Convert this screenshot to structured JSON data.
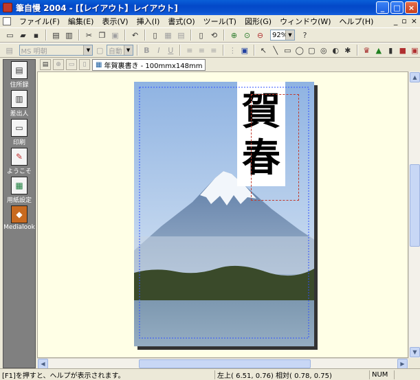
{
  "window": {
    "title": "筆自慢 2004 - [【レイアウト】レイアウト]",
    "minimize_label": "_",
    "maximize_label": "□",
    "close_label": "×"
  },
  "menu": {
    "items": [
      "ファイル(F)",
      "編集(E)",
      "表示(V)",
      "挿入(I)",
      "書式(O)",
      "ツール(T)",
      "図形(G)",
      "ウィンドウ(W)",
      "ヘルプ(H)"
    ],
    "mdi_controls": [
      "_",
      "▫",
      "×"
    ]
  },
  "toolbar1": {
    "zoom_value": "92%"
  },
  "toolbar2": {
    "font_name": "MS 明朝",
    "font_size": "自動"
  },
  "sidepanel": {
    "items": [
      {
        "label": "住所録",
        "icon": "address-book-icon"
      },
      {
        "label": "差出人",
        "icon": "sender-icon"
      },
      {
        "label": "印刷",
        "icon": "printer-icon"
      },
      {
        "label": "ようこそ",
        "icon": "welcome-icon"
      },
      {
        "label": "用紙設定",
        "icon": "paper-settings-icon"
      },
      {
        "label": "Medialook",
        "icon": "medialook-icon"
      }
    ]
  },
  "tabs": {
    "page_tab_label": "年賀裏書き - 100mmx148mm"
  },
  "postcard": {
    "greeting_text": "賀春",
    "colors": {
      "sky": "#9fc0e6",
      "mountain": "#6f8fb8",
      "snow": "#f2f6fb",
      "forest": "#3a4a2a",
      "lake": "#8aa6bd"
    }
  },
  "statusbar": {
    "help_text": "[F1]を押すと、ヘルプが表示されます。",
    "position_text": "左上( 6.51, 0.76) 相対( 0.78, 0.75)",
    "num_indicator": "NUM"
  }
}
